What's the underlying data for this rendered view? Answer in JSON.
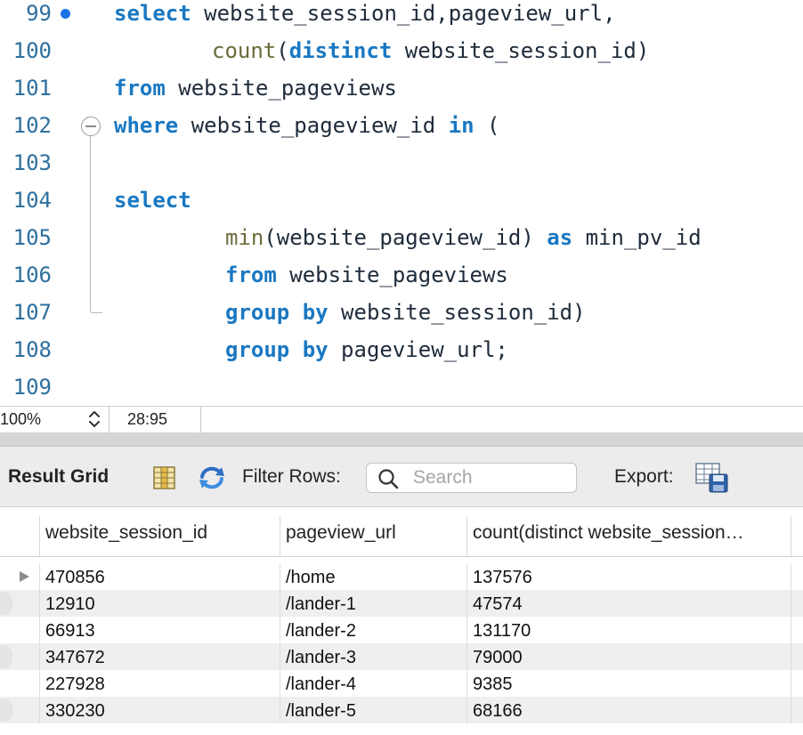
{
  "editor": {
    "lines": [
      {
        "num": "99",
        "indent": 0,
        "tokens": [
          [
            "kw",
            "select"
          ],
          [
            "tx",
            " website_session_id,pageview_url,"
          ]
        ]
      },
      {
        "num": "100",
        "indent": 1,
        "tokens": [
          [
            "fn",
            "count"
          ],
          [
            "tx",
            "("
          ],
          [
            "kw",
            "distinct"
          ],
          [
            "tx",
            " website_session_id)"
          ]
        ]
      },
      {
        "num": "101",
        "indent": 0,
        "tokens": [
          [
            "kw",
            "from"
          ],
          [
            "tx",
            " website_pageviews"
          ]
        ]
      },
      {
        "num": "102",
        "indent": 0,
        "tokens": [
          [
            "kw",
            "where"
          ],
          [
            "tx",
            " website_pageview_id "
          ],
          [
            "kw",
            "in"
          ],
          [
            "tx",
            " ("
          ]
        ]
      },
      {
        "num": "103",
        "indent": 0,
        "tokens": []
      },
      {
        "num": "104",
        "indent": 0,
        "tokens": [
          [
            "kw",
            "select"
          ]
        ]
      },
      {
        "num": "105",
        "indent": 2,
        "tokens": [
          [
            "fn",
            "min"
          ],
          [
            "tx",
            "(website_pageview_id) "
          ],
          [
            "kw",
            "as"
          ],
          [
            "tx",
            " min_pv_id"
          ]
        ]
      },
      {
        "num": "106",
        "indent": 2,
        "tokens": [
          [
            "kw",
            "from"
          ],
          [
            "tx",
            " website_pageviews"
          ]
        ]
      },
      {
        "num": "107",
        "indent": 2,
        "tokens": [
          [
            "kw",
            "group by"
          ],
          [
            "tx",
            " website_session_id)"
          ]
        ]
      },
      {
        "num": "108",
        "indent": 2,
        "tokens": [
          [
            "kw",
            "group by"
          ],
          [
            "tx",
            " pageview_url;"
          ]
        ]
      },
      {
        "num": "109",
        "indent": 0,
        "tokens": []
      }
    ]
  },
  "statusbar": {
    "zoom": "100%",
    "cursor_position": "28:95"
  },
  "result_toolbar": {
    "title": "Result Grid",
    "filter_label": "Filter Rows:",
    "search_placeholder": "Search",
    "search_value": "",
    "export_label": "Export:"
  },
  "grid": {
    "columns": [
      "website_session_id",
      "pageview_url",
      "count(distinct website_session…"
    ],
    "rows": [
      [
        "470856",
        "/home",
        "137576"
      ],
      [
        "12910",
        "/lander-1",
        "47574"
      ],
      [
        "66913",
        "/lander-2",
        "131170"
      ],
      [
        "347672",
        "/lander-3",
        "79000"
      ],
      [
        "227928",
        "/lander-4",
        "9385"
      ],
      [
        "330230",
        "/lander-5",
        "68166"
      ]
    ],
    "selected_row": 0
  },
  "icons": {
    "breakpoint": "breakpoint-dot-icon",
    "fold": "fold-collapse-icon",
    "stepper": "stepper-arrows-icon",
    "grid_view": "grid-columns-icon",
    "refresh": "refresh-arrows-icon",
    "search": "search-icon",
    "export": "export-table-icon",
    "row_pointer": "row-pointer-icon"
  },
  "colors": {
    "keyword": "#1a78c2",
    "function": "#6b6b3a",
    "line_number": "#2d6f9e",
    "breakpoint": "#1a73e8"
  }
}
